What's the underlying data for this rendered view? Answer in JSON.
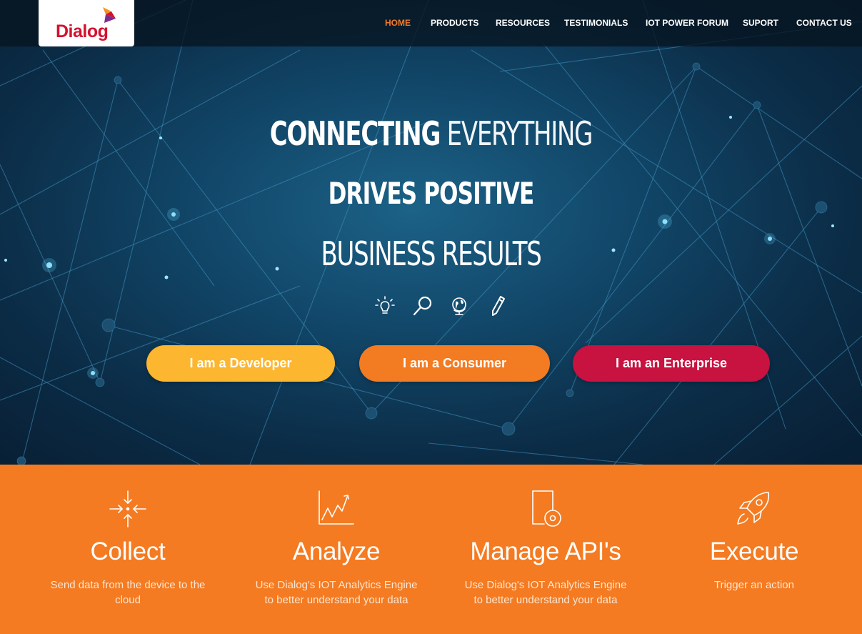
{
  "brand": {
    "name": "Dialog",
    "color": "#d3122e"
  },
  "nav": {
    "items": [
      {
        "label": "HOME",
        "active": true
      },
      {
        "label": "PRODUCTS",
        "active": false
      },
      {
        "label": "RESOURCES",
        "active": false
      },
      {
        "label": "TESTIMONIALS",
        "active": false
      },
      {
        "label": "IOT POWER FORUM",
        "active": false
      },
      {
        "label": "SUPORT",
        "active": false
      },
      {
        "label": "CONTACT US",
        "active": false
      }
    ]
  },
  "hero": {
    "line1_strong": "CONNECTING",
    "line1_thin": "EVERYTHING",
    "line2": "DRIVES POSITIVE",
    "line3": "BUSINESS RESULTS",
    "icons": [
      "lightbulb-icon",
      "magnifier-icon",
      "globe-icon",
      "pencil-icon"
    ]
  },
  "cta": {
    "developer": "I am a Developer",
    "consumer": "I am a Consumer",
    "enterprise": "I am an Enterprise"
  },
  "colors": {
    "accent_orange": "#f47b21",
    "developer_yellow": "#fcb630",
    "consumer_orange": "#f37b21",
    "enterprise_red": "#c8123f",
    "active_nav": "#f37b2a"
  },
  "features": [
    {
      "icon": "collect-arrows-icon",
      "title": "Collect",
      "desc_line1": "Send data from the device to the",
      "desc_line2": "cloud"
    },
    {
      "icon": "line-chart-icon",
      "title": "Analyze",
      "desc_line1": "Use Dialog's IOT Analytics Engine",
      "desc_line2": "to better understand your data"
    },
    {
      "icon": "api-device-icon",
      "title": "Manage API's",
      "desc_line1": "Use Dialog's IOT Analytics Engine",
      "desc_line2": "to better understand your data"
    },
    {
      "icon": "rocket-icon",
      "title": "Execute",
      "desc_line1": "Trigger an action",
      "desc_line2": ""
    }
  ]
}
